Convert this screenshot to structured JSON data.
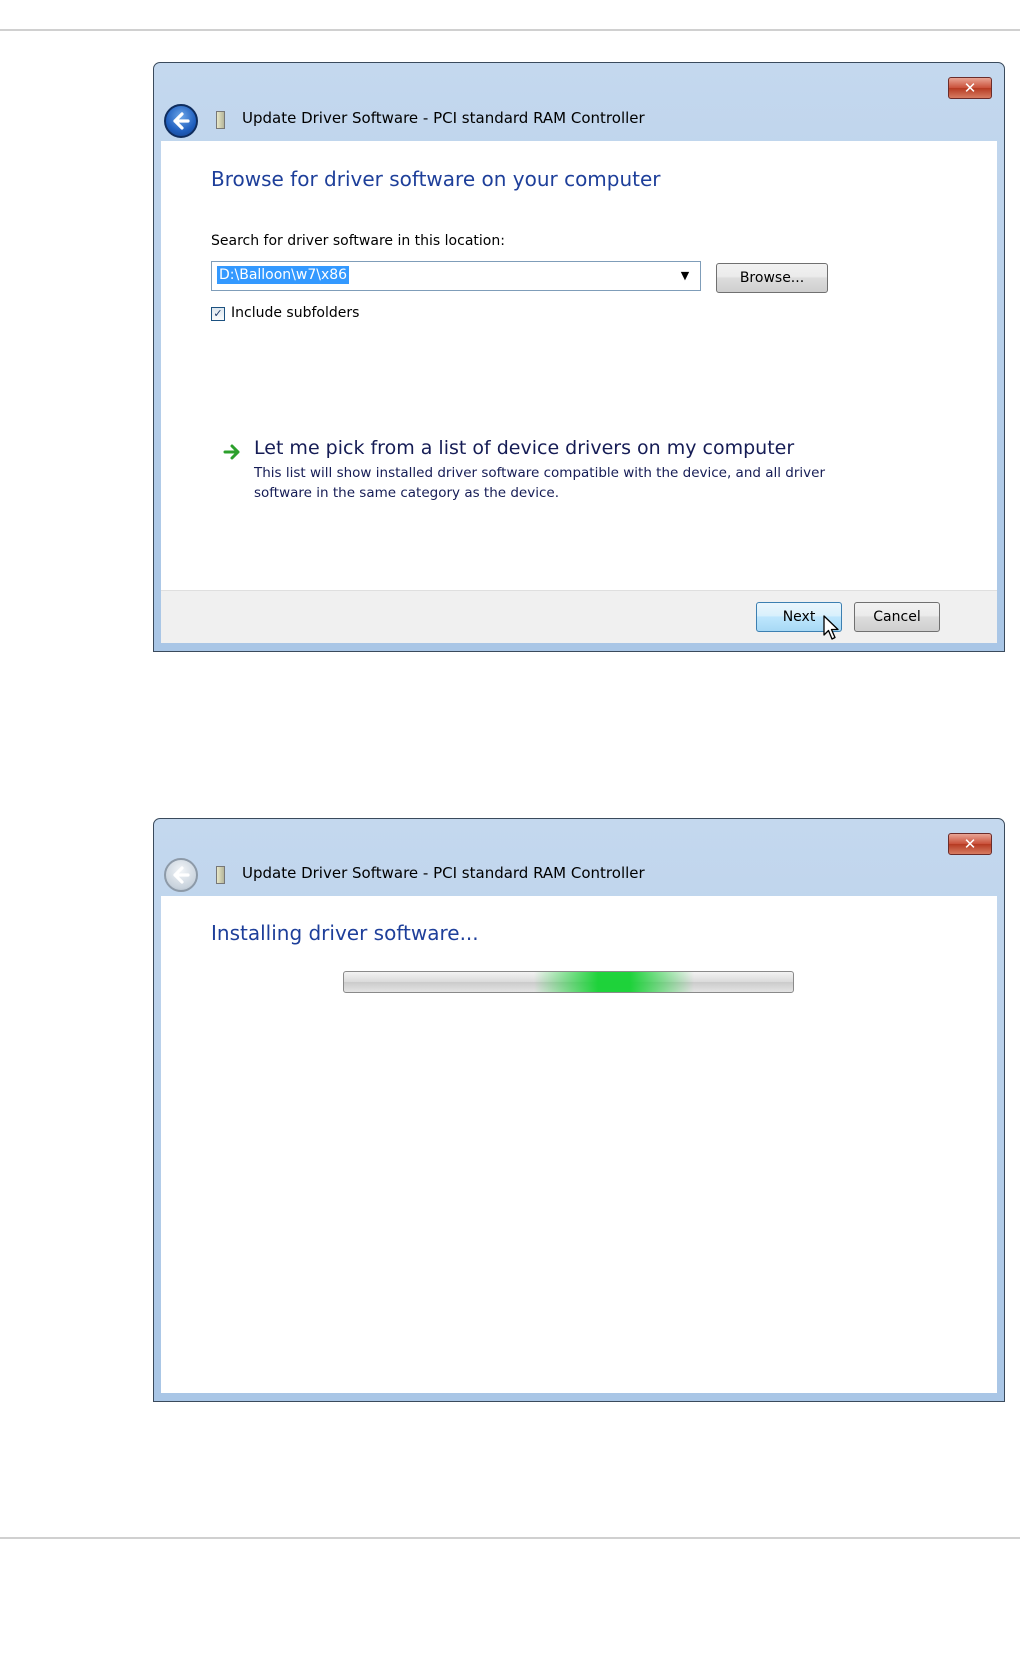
{
  "dialog1": {
    "title": "Update Driver Software - PCI standard RAM Controller",
    "close_label": "✕",
    "heading": "Browse for driver software on your computer",
    "search_label": "Search for driver software in this location:",
    "path_value": "D:\\Balloon\\w7\\x86",
    "browse_label": "Browse...",
    "include_subfolders_label": "Include subfolders",
    "include_subfolders_checked": true,
    "pick_link_title": "Let me pick from a list of device drivers on my computer",
    "pick_link_desc": "This list will show installed driver software compatible with the device, and all driver software in the same category as the device.",
    "next_label": "Next",
    "cancel_label": "Cancel"
  },
  "dialog2": {
    "title": "Update Driver Software - PCI standard RAM Controller",
    "close_label": "✕",
    "heading": "Installing driver software..."
  },
  "colors": {
    "accent_heading": "#1e3f9a",
    "selection": "#3399ff",
    "progress_glow": "#14d232"
  }
}
